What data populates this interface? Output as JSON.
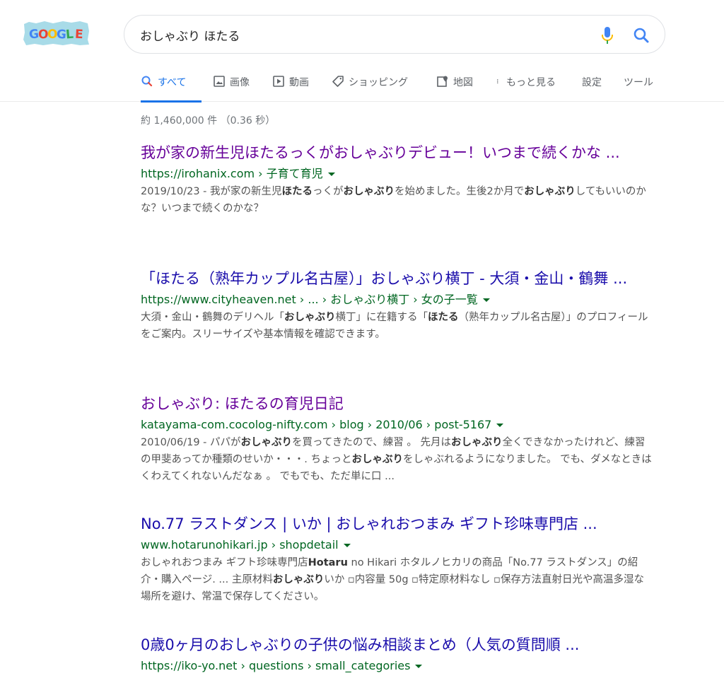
{
  "logo": {
    "text": "GOOGLE",
    "colors": [
      "#4285f4",
      "#ea4335",
      "#fbbc05",
      "#4285f4",
      "#34a853",
      "#ea4335"
    ],
    "bg": "#a8dbe8"
  },
  "search": {
    "value": "おしゃぶり ほたる",
    "mic_icon": "mic-icon",
    "search_icon": "magnifier-icon"
  },
  "tabs": [
    {
      "label": "すべて",
      "icon": "search-icon",
      "active": true
    },
    {
      "label": "画像",
      "icon": "image-icon"
    },
    {
      "label": "動画",
      "icon": "play-icon"
    },
    {
      "label": "ショッピング",
      "icon": "tag-icon"
    },
    {
      "label": "地図",
      "icon": "map-pin-icon"
    },
    {
      "label": "もっと見る",
      "icon": "more-vertical-icon"
    },
    {
      "label": "設定"
    },
    {
      "label": "ツール"
    }
  ],
  "stats": "約 1,460,000 件 （0.36 秒）",
  "results": [
    {
      "title": "我が家の新生児ほたるっくがおしゃぶりデビュー！いつまで続くかな ...",
      "visited": true,
      "url": "https://irohanix.com › 子育て育児",
      "snippet": "2019/10/23 - 我が家の新生児<b>ほたる</b>っくが<b>おしゃぶり</b>を始めました。生後2か月で<b>おしゃぶり</b>してもいいのかな？いつまで続くのかな？"
    },
    {
      "title": "「ほたる（熟年カップル名古屋）」おしゃぶり横丁 - 大須・金山・鶴舞 ...",
      "visited": false,
      "url": "https://www.cityheaven.net › ... › おしゃぶり横丁 › 女の子一覧",
      "snippet": "大須・金山・鶴舞のデリヘル「<b>おしゃぶり</b>横丁」に在籍する「<b>ほたる</b>（熟年カップル名古屋）」のプロフィールをご案内。スリーサイズや基本情報を確認できます。"
    },
    {
      "title": "おしゃぶり: ほたるの育児日記",
      "visited": true,
      "url": "katayama-com.cocolog-nifty.com › blog › 2010/06 › post-5167",
      "snippet": "2010/06/19 - パパが<b>おしゃぶり</b>を買ってきたので、練習 。 先月は<b>おしゃぶり</b>全くできなかったけれど、練習の甲斐あってか種類のせいか・・・. ちょっと<b>おしゃぶり</b>をしゃぶれるようになりました。 でも、ダメなときはくわえてくれないんだなぁ 。 でもでも、ただ単に口 ..."
    },
    {
      "title": "No.77 ラストダンス | いか | おしゃれおつまみ ギフト珍味専門店 ...",
      "visited": false,
      "url": "www.hotarunohikari.jp › shopdetail",
      "snippet": "おしゃれおつまみ ギフト珍味専門店<b>Hotaru</b> no Hikari ホタルノヒカリの商品「No.77 ラストダンス」の紹介・購入ページ. ... 主原材料<b>おしゃぶり</b>いか ▫内容量 50g ▫特定原材料なし ▫保存方法直射日光や高温多湿な場所を避け、常温で保存してください。"
    },
    {
      "title": "0歳0ヶ月のおしゃぶりの子供の悩み相談まとめ（人気の質問順 ...",
      "visited": false,
      "url": "https://iko-yo.net › questions › small_categories",
      "snippet": ""
    }
  ]
}
